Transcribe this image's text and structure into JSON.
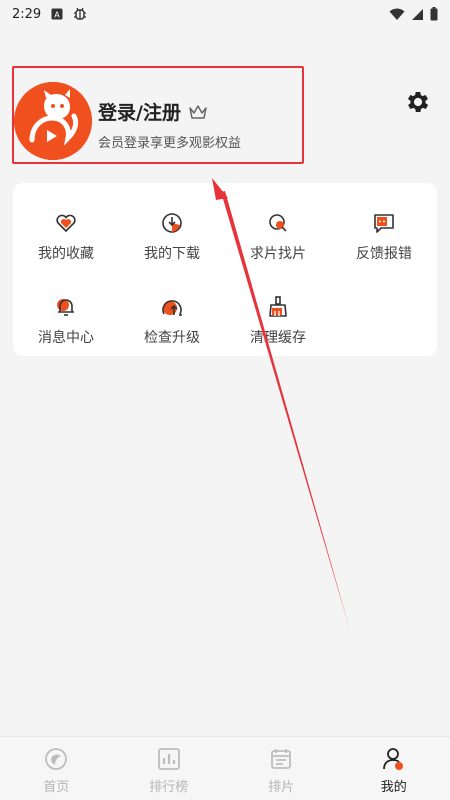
{
  "status_bar": {
    "time": "2:29",
    "icons_left": [
      "sim-a-icon",
      "bug-icon"
    ],
    "icons_right": [
      "wifi-icon",
      "signal-icon",
      "battery-icon"
    ]
  },
  "profile": {
    "title": "登录/注册",
    "subtitle": "会员登录享更多观影权益",
    "badge_icon": "crown-icon"
  },
  "menu": [
    {
      "label": "我的收藏",
      "icon": "heart-icon"
    },
    {
      "label": "我的下载",
      "icon": "download-icon"
    },
    {
      "label": "求片找片",
      "icon": "search-film-icon"
    },
    {
      "label": "反馈报错",
      "icon": "feedback-icon"
    },
    {
      "label": "消息中心",
      "icon": "bell-icon"
    },
    {
      "label": "检查升级",
      "icon": "upgrade-icon"
    },
    {
      "label": "清理缓存",
      "icon": "broom-icon"
    }
  ],
  "tabs": [
    {
      "label": "首页",
      "icon": "home-icon",
      "active": false
    },
    {
      "label": "排行榜",
      "icon": "ranking-icon",
      "active": false
    },
    {
      "label": "排片",
      "icon": "schedule-icon",
      "active": false
    },
    {
      "label": "我的",
      "icon": "profile-icon",
      "active": true
    }
  ],
  "colors": {
    "accent": "#f0501e",
    "annotation": "#e8333a",
    "background": "#f4f4f4"
  }
}
